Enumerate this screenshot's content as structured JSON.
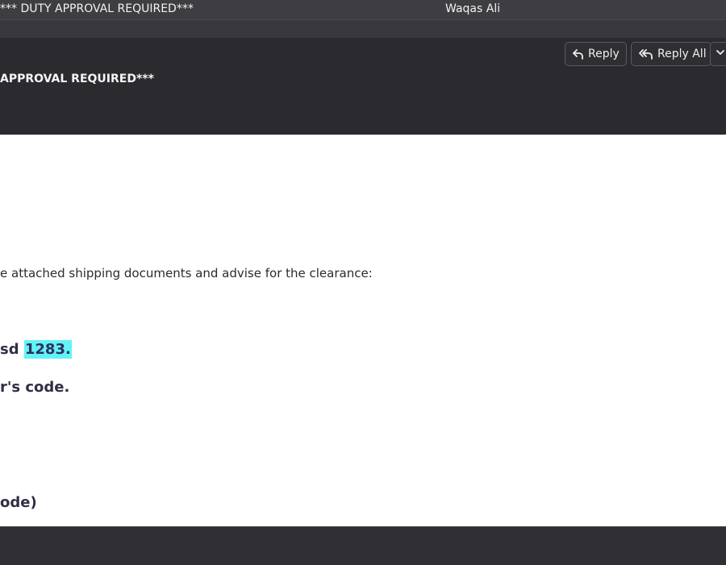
{
  "message_list": {
    "selected_subject": "*** DUTY APPROVAL REQUIRED***",
    "selected_sender": "Waqas Ali"
  },
  "header": {
    "subject": "APPROVAL REQUIRED***",
    "reply_label": "Reply",
    "reply_all_label": "Reply All"
  },
  "body": {
    "line1": "e attached shipping documents and advise for the clearance:",
    "line2_prefix": "sd ",
    "line2_highlight": "1283.",
    "line3": "r's code.",
    "line4": "ode)"
  },
  "colors": {
    "highlight": "#62f3f7",
    "dark_chrome": "#2a2a2f"
  }
}
